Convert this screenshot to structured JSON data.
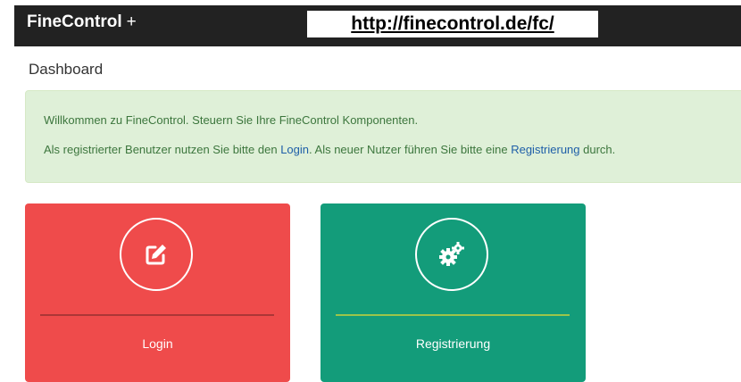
{
  "header": {
    "brand": "FineControl",
    "brand_plus": "+",
    "url": "http://finecontrol.de/fc/"
  },
  "page": {
    "title": "Dashboard"
  },
  "alert": {
    "line1": "Willkommen zu FineControl. Steuern Sie Ihre FineControl Komponenten.",
    "line2_part1": "Als registrierter Benutzer nutzen Sie bitte den ",
    "login_link": "Login",
    "line2_part2": ". Als neuer Nutzer führen Sie bitte eine ",
    "register_link": "Registrierung",
    "line2_part3": " durch."
  },
  "cards": [
    {
      "label": "Login",
      "icon": "edit-icon",
      "color": "#ef4b4b"
    },
    {
      "label": "Registrierung",
      "icon": "gears-icon",
      "color": "#139c7a"
    }
  ],
  "colors": {
    "navbar": "#222222",
    "alert_bg": "#dff0d8",
    "alert_text": "#3c763d",
    "link": "#1f5fa8"
  }
}
